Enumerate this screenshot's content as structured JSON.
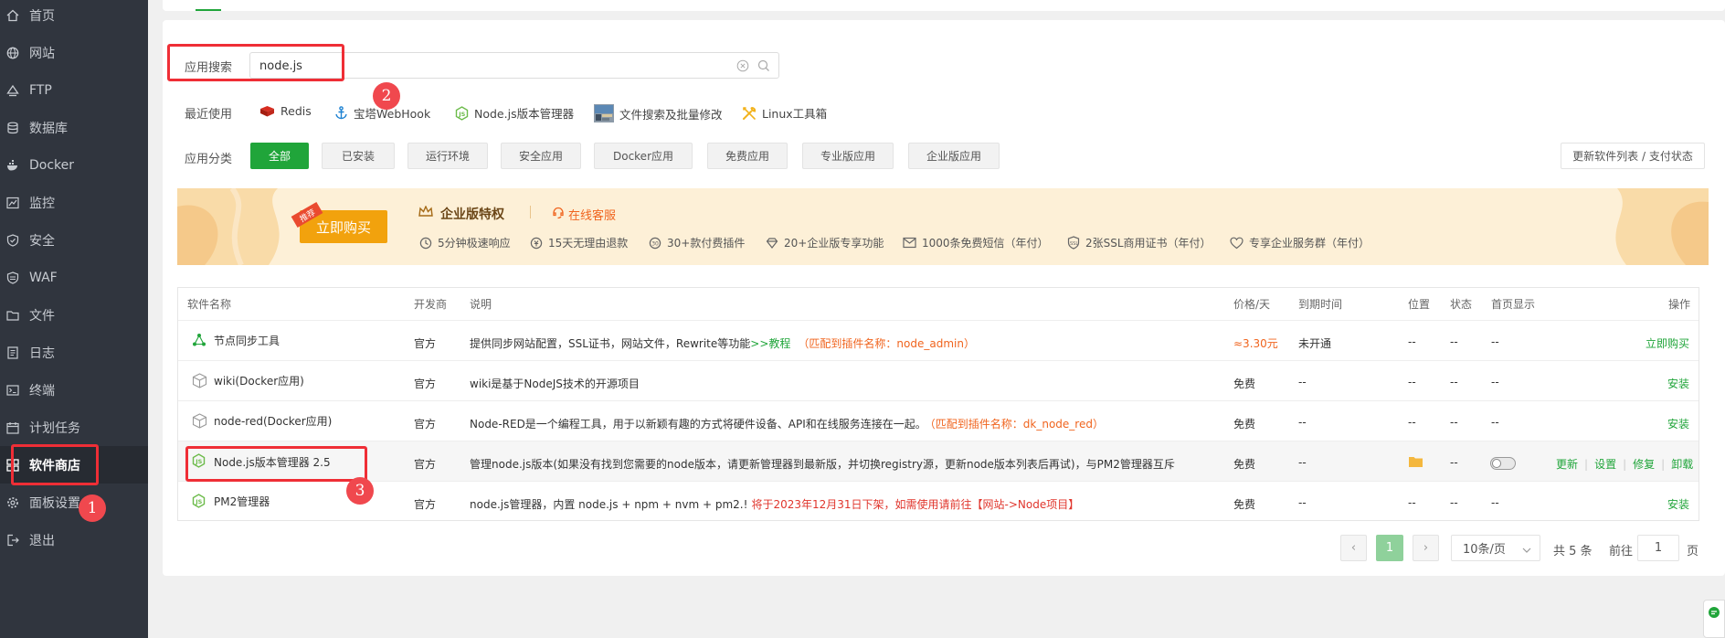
{
  "sidebar": {
    "items": [
      {
        "label": "首页",
        "icon": "home-icon"
      },
      {
        "label": "网站",
        "icon": "globe-icon"
      },
      {
        "label": "FTP",
        "icon": "ftp-icon"
      },
      {
        "label": "数据库",
        "icon": "database-icon"
      },
      {
        "label": "Docker",
        "icon": "docker-icon"
      },
      {
        "label": "监控",
        "icon": "monitor-icon"
      },
      {
        "label": "安全",
        "icon": "shield-icon"
      },
      {
        "label": "WAF",
        "icon": "waf-icon"
      },
      {
        "label": "文件",
        "icon": "folder-icon"
      },
      {
        "label": "日志",
        "icon": "log-icon"
      },
      {
        "label": "终端",
        "icon": "terminal-icon"
      },
      {
        "label": "计划任务",
        "icon": "calendar-icon"
      },
      {
        "label": "软件商店",
        "icon": "apps-icon"
      },
      {
        "label": "面板设置",
        "icon": "gear-icon"
      },
      {
        "label": "退出",
        "icon": "logout-icon"
      }
    ],
    "active_index": 12
  },
  "annotations": {
    "b1": "1",
    "b2": "2",
    "b3": "3"
  },
  "search": {
    "label": "应用搜索",
    "value": "node.js",
    "placeholder": ""
  },
  "recent": {
    "label": "最近使用",
    "items": [
      "Redis",
      "宝塔WebHook",
      "Node.js版本管理器",
      "文件搜索及批量修改",
      "Linux工具箱"
    ]
  },
  "categories": {
    "label": "应用分类",
    "items": [
      "全部",
      "已安装",
      "运行环境",
      "安全应用",
      "Docker应用",
      "免费应用",
      "专业版应用",
      "企业版应用"
    ],
    "active_index": 0,
    "update_button": "更新软件列表 / 支付状态"
  },
  "banner": {
    "ribbon": "推荐",
    "buy_button": "立即购买",
    "title": "企业版特权",
    "service": "在线客服",
    "features": [
      "5分钟极速响应",
      "15天无理由退款",
      "30+款付费插件",
      "20+企业版专享功能",
      "1000条免费短信（年付）",
      "2张SSL商用证书（年付）",
      "专享企业服务群（年付）"
    ]
  },
  "table": {
    "headers": [
      "软件名称",
      "开发商",
      "说明",
      "价格/天",
      "到期时间",
      "位置",
      "状态",
      "首页显示",
      "操作"
    ],
    "rows": [
      {
        "name": "节点同步工具",
        "vendor": "官方",
        "desc": "提供同步网站配置，SSL证书，网站文件，Rewrite等功能",
        "desc_link": ">>教程",
        "desc_note": "（匹配到插件名称：node_admin）",
        "price": "≈3.30元",
        "expire": "未开通",
        "location": "--",
        "status": "--",
        "home": "--",
        "actions": [
          "立即购买"
        ]
      },
      {
        "name": "wiki(Docker应用)",
        "vendor": "官方",
        "desc": "wiki是基于NodeJS技术的开源项目",
        "desc_link": "",
        "desc_note": "",
        "price": "免费",
        "expire": "--",
        "location": "--",
        "status": "--",
        "home": "--",
        "actions": [
          "安装"
        ]
      },
      {
        "name": "node-red(Docker应用)",
        "vendor": "官方",
        "desc": "Node-RED是一个编程工具，用于以新颖有趣的方式将硬件设备、API和在线服务连接在一起。",
        "desc_link": "",
        "desc_note": "（匹配到插件名称：dk_node_red）",
        "price": "免费",
        "expire": "--",
        "location": "--",
        "status": "--",
        "home": "--",
        "actions": [
          "安装"
        ]
      },
      {
        "name": "Node.js版本管理器 2.5",
        "vendor": "官方",
        "desc": "管理node.js版本(如果没有找到您需要的node版本，请更新管理器到最新版，并切换registry源，更新node版本列表后再试)，与PM2管理器互斥",
        "desc_link": "",
        "desc_note": "",
        "price": "免费",
        "expire": "--",
        "location": "",
        "status": "--",
        "home": "",
        "actions": [
          "更新",
          "设置",
          "修复",
          "卸载"
        ]
      },
      {
        "name": "PM2管理器",
        "vendor": "官方",
        "desc": "node.js管理器，内置 node.js + npm + nvm + pm2.!",
        "desc_link": "",
        "desc_note": "将于2023年12月31日下架，如需使用请前往【网站->Node项目】",
        "price": "免费",
        "expire": "--",
        "location": "--",
        "status": "--",
        "home": "--",
        "actions": [
          "安装"
        ]
      }
    ]
  },
  "pagination": {
    "prev": "‹",
    "current": "1",
    "next": "›",
    "page_size": "10条/页",
    "total": "共 5 条",
    "goto_label": "前往",
    "goto_value": "1",
    "page_suffix": "页"
  },
  "colors": {
    "accent": "#20a53a",
    "annotation": "#ef2e36",
    "sidebar": "#30353e",
    "note": "#f0641e"
  }
}
